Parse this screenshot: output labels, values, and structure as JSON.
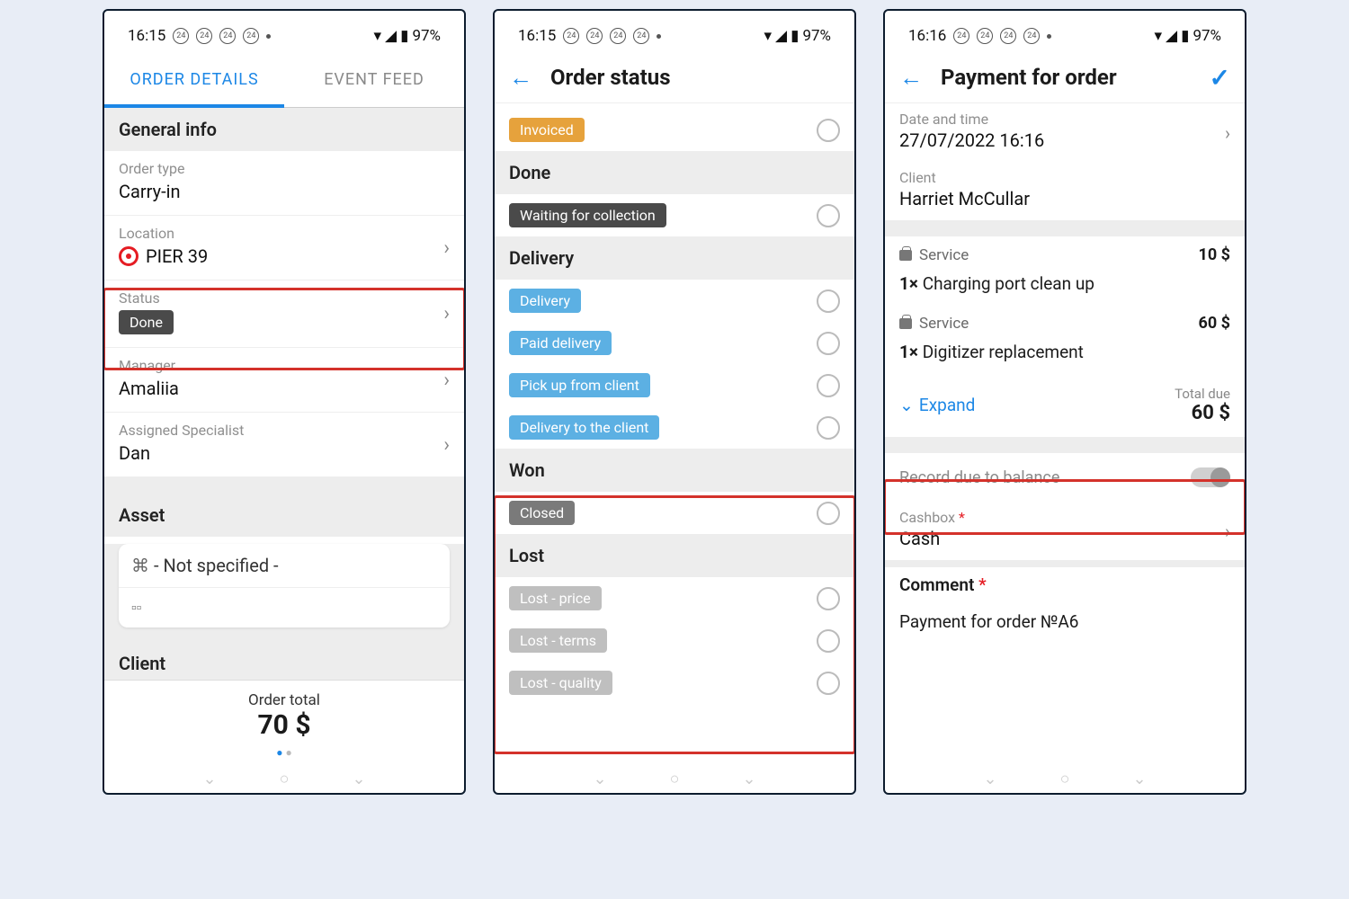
{
  "status_bar": {
    "time1": "16:15",
    "time2": "16:15",
    "time3": "16:16",
    "small": "24",
    "battery": "97%"
  },
  "p1": {
    "tab1": "ORDER DETAILS",
    "tab2": "EVENT FEED",
    "general_info": "General info",
    "order_type_label": "Order type",
    "order_type_value": "Carry-in",
    "location_label": "Location",
    "location_value": "PIER 39",
    "status_label": "Status",
    "status_badge": "Done",
    "manager_label": "Manager",
    "manager_value": "Amaliia",
    "specialist_label": "Assigned Specialist",
    "specialist_value": "Dan",
    "asset_header": "Asset",
    "asset_value": "- Not specified -",
    "client_header": "Client",
    "order_total_label": "Order total",
    "order_total_value": "70 $"
  },
  "p2": {
    "title": "Order status",
    "badge_invoiced": "Invoiced",
    "sect_done": "Done",
    "badge_waiting": "Waiting for collection",
    "sect_delivery": "Delivery",
    "badge_delivery": "Delivery",
    "badge_paiddel": "Paid delivery",
    "badge_pickup": "Pick up from client",
    "badge_deltoclient": "Delivery to the client",
    "sect_won": "Won",
    "badge_closed": "Closed",
    "sect_lost": "Lost",
    "badge_lostprice": "Lost - price",
    "badge_lostterms": "Lost - terms",
    "badge_lostquality": "Lost - quality"
  },
  "p3": {
    "title": "Payment for order",
    "date_label": "Date and time",
    "date_value": "27/07/2022 16:16",
    "client_label": "Client",
    "client_value": "Harriet McCullar",
    "svc_label": "Service",
    "svc1_price": "10 $",
    "svc1_line": "1× Charging port clean up",
    "svc2_price": "60 $",
    "svc2_line": "1× Digitizer replacement",
    "expand": "Expand",
    "totaldue_label": "Total due",
    "totaldue_value": "60 $",
    "record_due": "Record due to balance",
    "cashbox_label": "Cashbox",
    "cashbox_value": "Cash",
    "comment_label": "Comment",
    "comment_value": "Payment for order №A6"
  }
}
